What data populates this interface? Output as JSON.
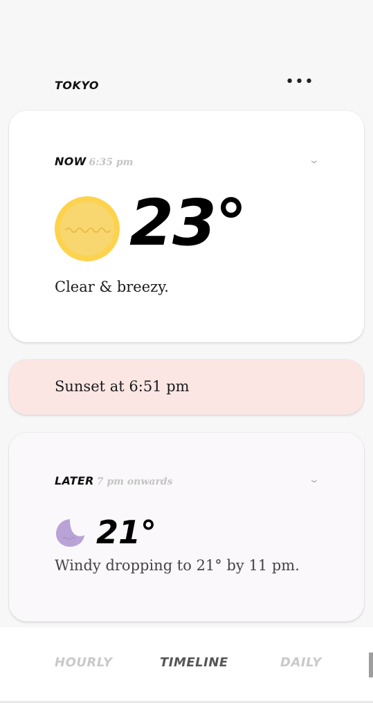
{
  "header": {
    "city": "TOKYO",
    "menu_icon": "more-horizontal-icon",
    "menu_glyph": "•••"
  },
  "now": {
    "label": "NOW",
    "time": "6:35 pm",
    "icon": "sun-icon",
    "temperature": "23°",
    "description": "Clear & breezy.",
    "chevron": "⌄"
  },
  "sunset": {
    "text": "Sunset at 6:51 pm"
  },
  "later": {
    "label": "LATER",
    "time": "7 pm onwards",
    "icon": "moon-icon",
    "temperature": "21°",
    "description": "Windy dropping to 21° by 11 pm.",
    "chevron": "⌄"
  },
  "tabs": {
    "hourly": "HOURLY",
    "timeline": "TIMELINE",
    "daily": "DAILY",
    "active": "TIMELINE"
  },
  "colors": {
    "sun": "#fdd34e",
    "sunset_bg": "#fbe6e4",
    "moon": "#b9a3d6",
    "later_bg": "#fbf8fb"
  }
}
